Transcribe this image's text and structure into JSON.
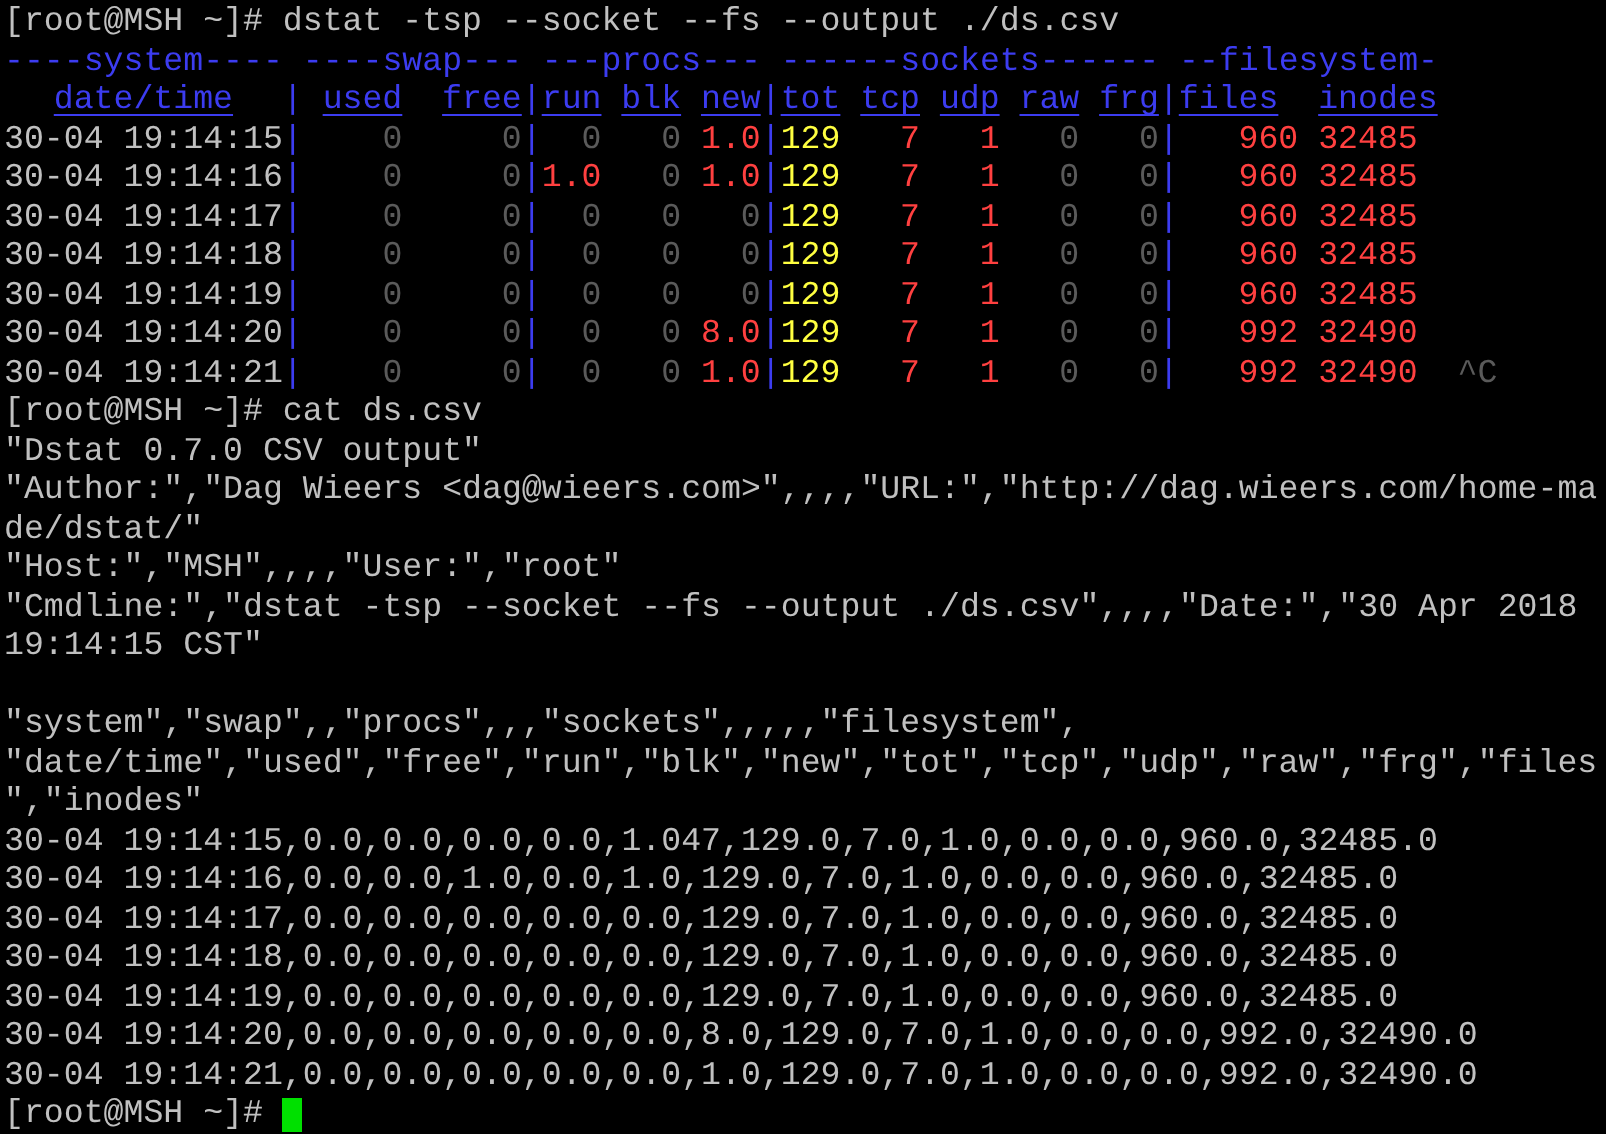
{
  "terminal": {
    "lines": [
      {
        "kind": "command",
        "prompt": "[root@MSH ~]#",
        "command": "dstat -tsp --socket --fs --output ./ds.csv"
      },
      {
        "kind": "dstat",
        "separator": "|",
        "groups": [
          {
            "title": "----system----",
            "columns": [
              "date/time"
            ]
          },
          {
            "title": "----swap---",
            "columns": [
              "used",
              "free"
            ]
          },
          {
            "title": "---procs---",
            "columns": [
              "run",
              "blk",
              "new"
            ]
          },
          {
            "title": "------sockets------",
            "columns": [
              "tot",
              "tcp",
              "udp",
              "raw",
              "frg"
            ]
          },
          {
            "title": "--filesystem-",
            "columns": [
              "files",
              "inodes"
            ]
          }
        ],
        "rows": [
          {
            "time": "30-04 19:14:15",
            "cells": [
              {
                "text": "0",
                "color": "#5a5a5a"
              },
              {
                "text": "0",
                "color": "#5a5a5a"
              },
              {
                "text": "0",
                "color": "#5a5a5a"
              },
              {
                "text": "0",
                "color": "#5a5a5a"
              },
              {
                "text": "1.0",
                "color": "#ff4040"
              },
              {
                "text": "129",
                "color": "#ffff40"
              },
              {
                "text": "7",
                "color": "#ff4040"
              },
              {
                "text": "1",
                "color": "#ff4040"
              },
              {
                "text": "0",
                "color": "#5a5a5a"
              },
              {
                "text": "0",
                "color": "#5a5a5a"
              },
              {
                "text": "960",
                "color": "#ff4040"
              },
              {
                "text": "32485",
                "color": "#ff4040"
              }
            ]
          },
          {
            "time": "30-04 19:14:16",
            "cells": [
              {
                "text": "0",
                "color": "#5a5a5a"
              },
              {
                "text": "0",
                "color": "#5a5a5a"
              },
              {
                "text": "1.0",
                "color": "#ff4040"
              },
              {
                "text": "0",
                "color": "#5a5a5a"
              },
              {
                "text": "1.0",
                "color": "#ff4040"
              },
              {
                "text": "129",
                "color": "#ffff40"
              },
              {
                "text": "7",
                "color": "#ff4040"
              },
              {
                "text": "1",
                "color": "#ff4040"
              },
              {
                "text": "0",
                "color": "#5a5a5a"
              },
              {
                "text": "0",
                "color": "#5a5a5a"
              },
              {
                "text": "960",
                "color": "#ff4040"
              },
              {
                "text": "32485",
                "color": "#ff4040"
              }
            ]
          },
          {
            "time": "30-04 19:14:17",
            "cells": [
              {
                "text": "0",
                "color": "#5a5a5a"
              },
              {
                "text": "0",
                "color": "#5a5a5a"
              },
              {
                "text": "0",
                "color": "#5a5a5a"
              },
              {
                "text": "0",
                "color": "#5a5a5a"
              },
              {
                "text": "0",
                "color": "#5a5a5a"
              },
              {
                "text": "129",
                "color": "#ffff40"
              },
              {
                "text": "7",
                "color": "#ff4040"
              },
              {
                "text": "1",
                "color": "#ff4040"
              },
              {
                "text": "0",
                "color": "#5a5a5a"
              },
              {
                "text": "0",
                "color": "#5a5a5a"
              },
              {
                "text": "960",
                "color": "#ff4040"
              },
              {
                "text": "32485",
                "color": "#ff4040"
              }
            ]
          },
          {
            "time": "30-04 19:14:18",
            "cells": [
              {
                "text": "0",
                "color": "#5a5a5a"
              },
              {
                "text": "0",
                "color": "#5a5a5a"
              },
              {
                "text": "0",
                "color": "#5a5a5a"
              },
              {
                "text": "0",
                "color": "#5a5a5a"
              },
              {
                "text": "0",
                "color": "#5a5a5a"
              },
              {
                "text": "129",
                "color": "#ffff40"
              },
              {
                "text": "7",
                "color": "#ff4040"
              },
              {
                "text": "1",
                "color": "#ff4040"
              },
              {
                "text": "0",
                "color": "#5a5a5a"
              },
              {
                "text": "0",
                "color": "#5a5a5a"
              },
              {
                "text": "960",
                "color": "#ff4040"
              },
              {
                "text": "32485",
                "color": "#ff4040"
              }
            ]
          },
          {
            "time": "30-04 19:14:19",
            "cells": [
              {
                "text": "0",
                "color": "#5a5a5a"
              },
              {
                "text": "0",
                "color": "#5a5a5a"
              },
              {
                "text": "0",
                "color": "#5a5a5a"
              },
              {
                "text": "0",
                "color": "#5a5a5a"
              },
              {
                "text": "0",
                "color": "#5a5a5a"
              },
              {
                "text": "129",
                "color": "#ffff40"
              },
              {
                "text": "7",
                "color": "#ff4040"
              },
              {
                "text": "1",
                "color": "#ff4040"
              },
              {
                "text": "0",
                "color": "#5a5a5a"
              },
              {
                "text": "0",
                "color": "#5a5a5a"
              },
              {
                "text": "960",
                "color": "#ff4040"
              },
              {
                "text": "32485",
                "color": "#ff4040"
              }
            ]
          },
          {
            "time": "30-04 19:14:20",
            "cells": [
              {
                "text": "0",
                "color": "#5a5a5a"
              },
              {
                "text": "0",
                "color": "#5a5a5a"
              },
              {
                "text": "0",
                "color": "#5a5a5a"
              },
              {
                "text": "0",
                "color": "#5a5a5a"
              },
              {
                "text": "8.0",
                "color": "#ff4040"
              },
              {
                "text": "129",
                "color": "#ffff40"
              },
              {
                "text": "7",
                "color": "#ff4040"
              },
              {
                "text": "1",
                "color": "#ff4040"
              },
              {
                "text": "0",
                "color": "#5a5a5a"
              },
              {
                "text": "0",
                "color": "#5a5a5a"
              },
              {
                "text": "992",
                "color": "#ff4040"
              },
              {
                "text": "32490",
                "color": "#ff4040"
              }
            ]
          },
          {
            "time": "30-04 19:14:21",
            "trailing": "^C",
            "cells": [
              {
                "text": "0",
                "color": "#5a5a5a"
              },
              {
                "text": "0",
                "color": "#5a5a5a"
              },
              {
                "text": "0",
                "color": "#5a5a5a"
              },
              {
                "text": "0",
                "color": "#5a5a5a"
              },
              {
                "text": "1.0",
                "color": "#ff4040"
              },
              {
                "text": "129",
                "color": "#ffff40"
              },
              {
                "text": "7",
                "color": "#ff4040"
              },
              {
                "text": "1",
                "color": "#ff4040"
              },
              {
                "text": "0",
                "color": "#5a5a5a"
              },
              {
                "text": "0",
                "color": "#5a5a5a"
              },
              {
                "text": "992",
                "color": "#ff4040"
              },
              {
                "text": "32490",
                "color": "#ff4040"
              }
            ]
          }
        ]
      },
      {
        "kind": "command",
        "prompt": "[root@MSH ~]#",
        "command": "cat ds.csv"
      },
      {
        "kind": "output",
        "text": "\"Dstat 0.7.0 CSV output\""
      },
      {
        "kind": "output",
        "text": "\"Author:\",\"Dag Wieers <dag@wieers.com>\",,,,\"URL:\",\"http://dag.wieers.com/home-ma"
      },
      {
        "kind": "output",
        "text": "de/dstat/\""
      },
      {
        "kind": "output",
        "text": "\"Host:\",\"MSH\",,,,\"User:\",\"root\""
      },
      {
        "kind": "output",
        "text": "\"Cmdline:\",\"dstat -tsp --socket --fs --output ./ds.csv\",,,,\"Date:\",\"30 Apr 2018"
      },
      {
        "kind": "output",
        "text": "19:14:15 CST\""
      },
      {
        "kind": "blank"
      },
      {
        "kind": "output",
        "text": "\"system\",\"swap\",,\"procs\",,,\"sockets\",,,,,\"filesystem\","
      },
      {
        "kind": "output",
        "text": "\"date/time\",\"used\",\"free\",\"run\",\"blk\",\"new\",\"tot\",\"tcp\",\"udp\",\"raw\",\"frg\",\"files"
      },
      {
        "kind": "output",
        "text": "\",\"inodes\""
      },
      {
        "kind": "output",
        "text": "30-04 19:14:15,0.0,0.0,0.0,0.0,1.047,129.0,7.0,1.0,0.0,0.0,960.0,32485.0"
      },
      {
        "kind": "output",
        "text": "30-04 19:14:16,0.0,0.0,1.0,0.0,1.0,129.0,7.0,1.0,0.0,0.0,960.0,32485.0"
      },
      {
        "kind": "output",
        "text": "30-04 19:14:17,0.0,0.0,0.0,0.0,0.0,129.0,7.0,1.0,0.0,0.0,960.0,32485.0"
      },
      {
        "kind": "output",
        "text": "30-04 19:14:18,0.0,0.0,0.0,0.0,0.0,129.0,7.0,1.0,0.0,0.0,960.0,32485.0"
      },
      {
        "kind": "output",
        "text": "30-04 19:14:19,0.0,0.0,0.0,0.0,0.0,129.0,7.0,1.0,0.0,0.0,960.0,32485.0"
      },
      {
        "kind": "output",
        "text": "30-04 19:14:20,0.0,0.0,0.0,0.0,0.0,8.0,129.0,7.0,1.0,0.0,0.0,992.0,32490.0"
      },
      {
        "kind": "output",
        "text": "30-04 19:14:21,0.0,0.0,0.0,0.0,0.0,1.0,129.0,7.0,1.0,0.0,0.0,992.0,32490.0"
      },
      {
        "kind": "command",
        "prompt": "[root@MSH ~]#",
        "cursor": true
      }
    ]
  }
}
